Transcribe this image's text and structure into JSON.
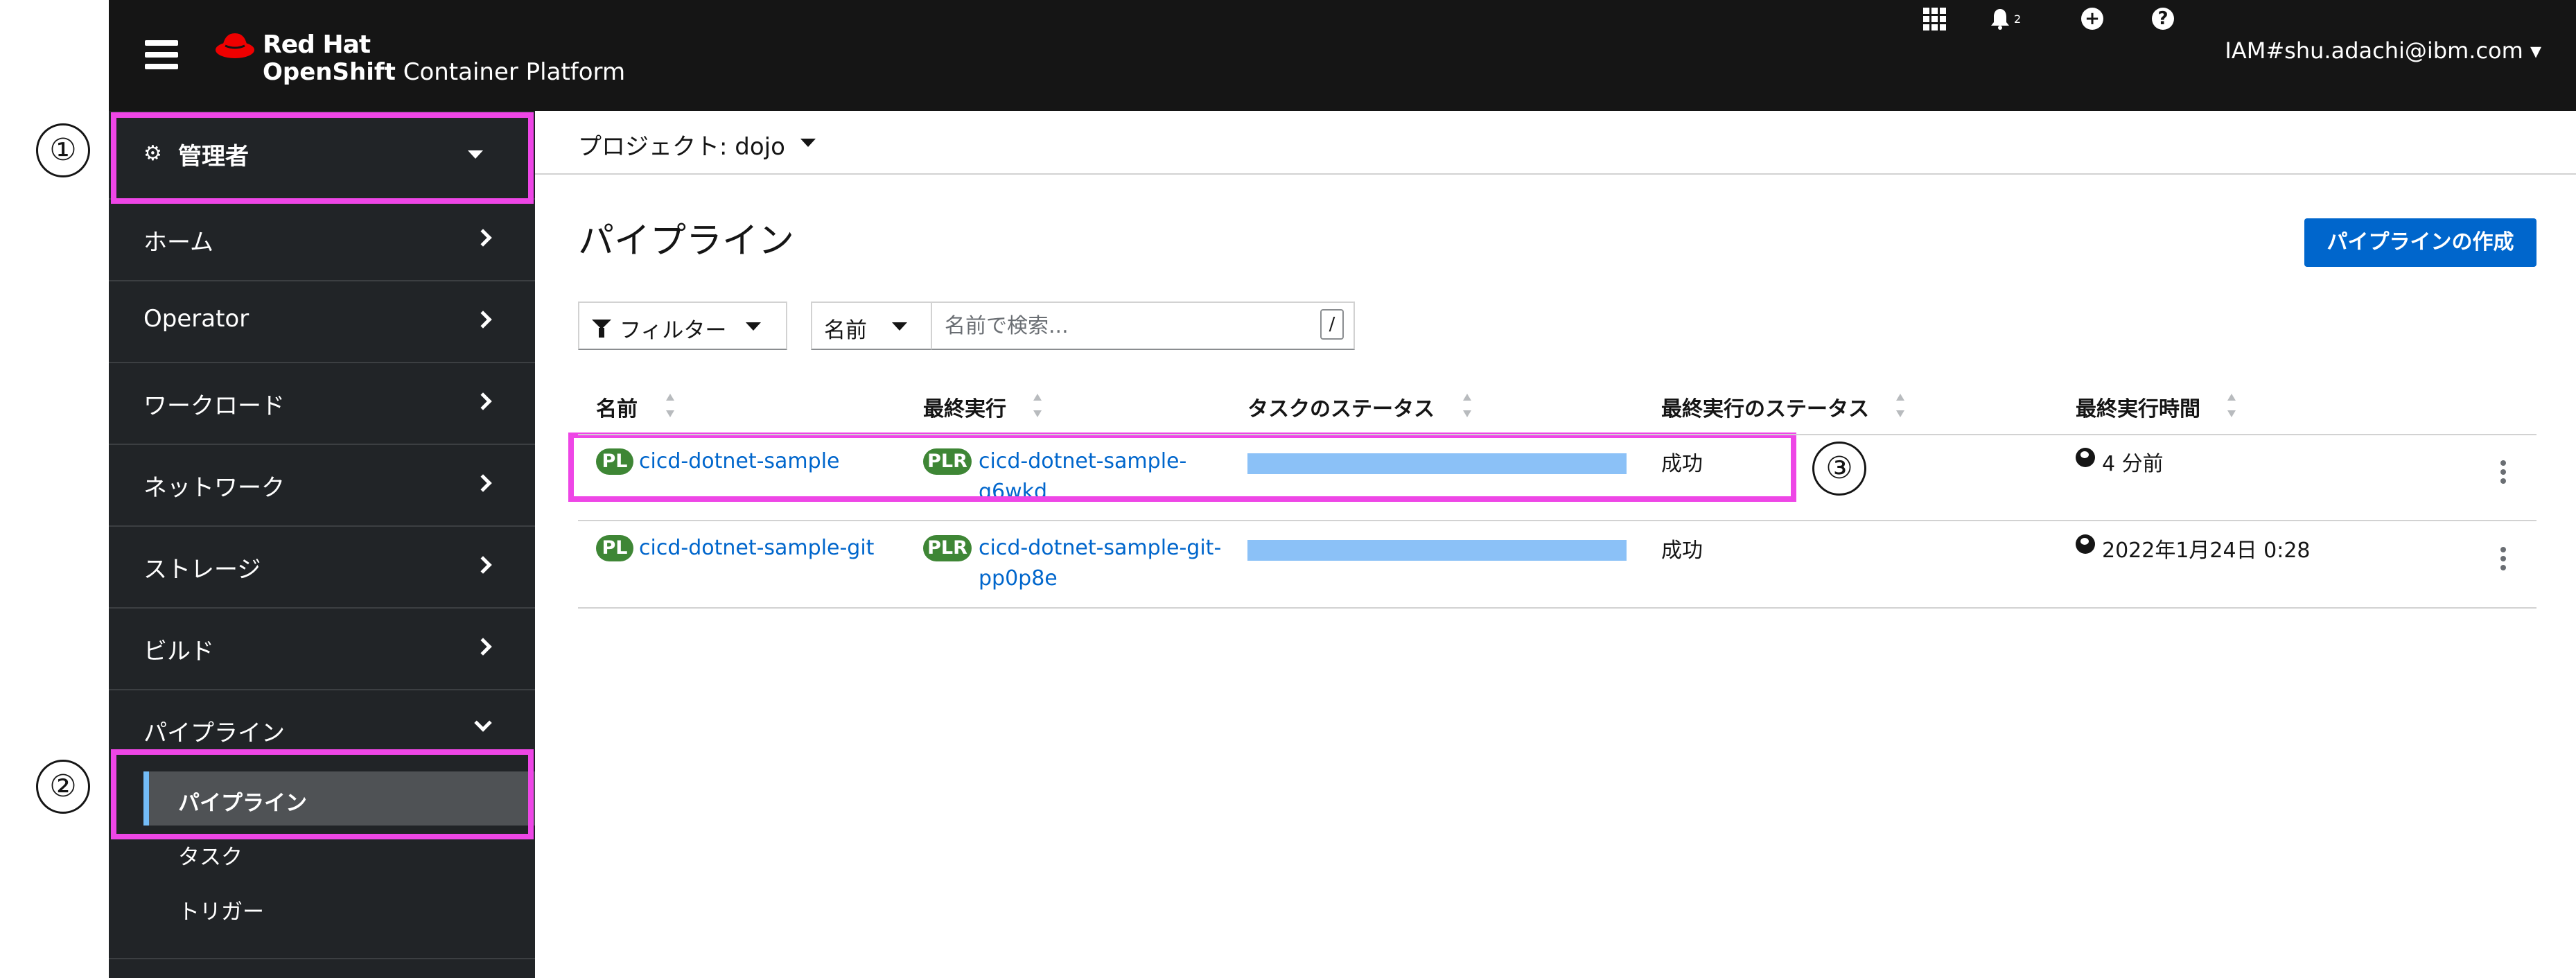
{
  "masthead": {
    "brand_line1": "Red Hat",
    "brand_line2_strong": "OpenShift",
    "brand_line2_rest": " Container Platform",
    "notification_count": "2",
    "user": "IAM#shu.adachi@ibm.com"
  },
  "annotations": [
    "①",
    "②",
    "③"
  ],
  "sidebar": {
    "perspective": "管理者",
    "items": [
      {
        "label": "ホーム"
      },
      {
        "label": "Operator"
      },
      {
        "label": "ワークロード"
      },
      {
        "label": "ネットワーク"
      },
      {
        "label": "ストレージ"
      },
      {
        "label": "ビルド"
      },
      {
        "label": "パイプライン"
      }
    ],
    "subitems": [
      {
        "label": "パイプライン"
      },
      {
        "label": "タスク"
      },
      {
        "label": "トリガー"
      }
    ]
  },
  "project": {
    "label": "プロジェクト: dojo"
  },
  "page": {
    "title": "パイプライン",
    "create_button": "パイプラインの作成"
  },
  "toolbar": {
    "filter_label": "フィルター",
    "name_dropdown": "名前",
    "search_placeholder": "名前で検索...",
    "shortcut": "/"
  },
  "table": {
    "headers": [
      "名前",
      "最終実行",
      "タスクのステータス",
      "最終実行のステータス",
      "最終実行時間"
    ],
    "rows": [
      {
        "pl_badge": "PL",
        "name": "cicd-dotnet-sample",
        "plr_badge": "PLR",
        "last_run_line1": "cicd-dotnet-sample-",
        "last_run_line2": "q6wkd",
        "task_status_progress": 1.0,
        "status": "成功",
        "time": "4 分前"
      },
      {
        "pl_badge": "PL",
        "name": "cicd-dotnet-sample-git",
        "plr_badge": "PLR",
        "last_run_line1": "cicd-dotnet-sample-git-",
        "last_run_line2": "pp0p8e",
        "task_status_progress": 1.0,
        "status": "成功",
        "time": "2022年1月24日 0:28"
      }
    ]
  },
  "colors": {
    "masthead_bg": "#151515",
    "sidebar_bg": "#212427",
    "highlight": "#ee46e6",
    "link": "#0066cc",
    "badge_green": "#3e8635",
    "task_bar": "#8bc1f7",
    "primary_button": "#0066cc"
  },
  "icons": [
    "hamburger-icon",
    "redhat-logo-icon",
    "app-launcher-icon",
    "bell-icon",
    "plus-circle-icon",
    "help-icon",
    "cogs-icon",
    "filter-icon",
    "globe-icon",
    "kebab-icon"
  ]
}
